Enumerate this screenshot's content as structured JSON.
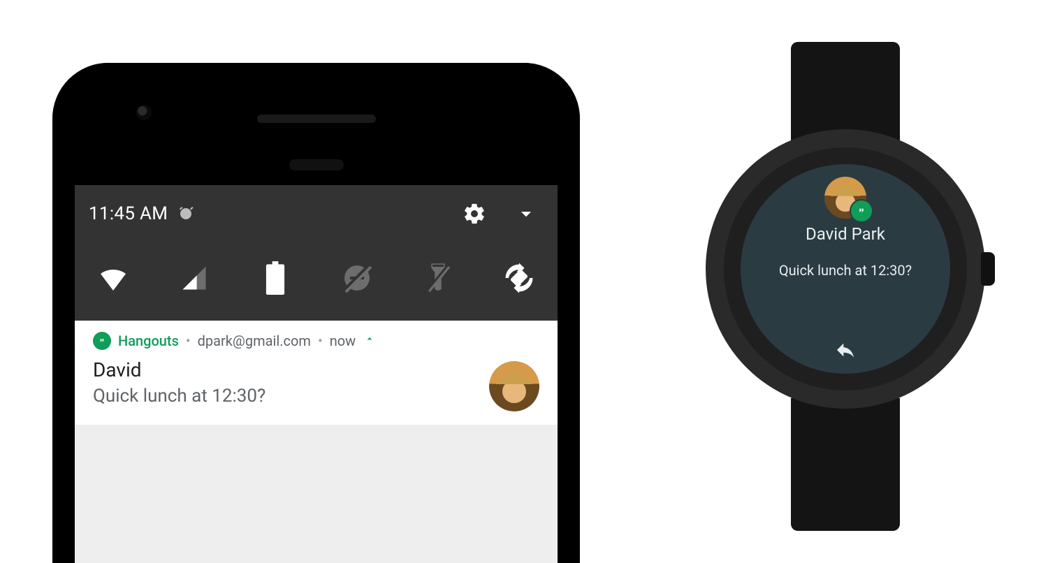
{
  "phone": {
    "status": {
      "time": "11:45 AM"
    },
    "quick_settings": {
      "tiles": [
        "wifi",
        "cellular",
        "battery",
        "dnd-off",
        "flashlight-off",
        "auto-rotate"
      ]
    },
    "notification": {
      "app_name": "Hangouts",
      "account": "dpark@gmail.com",
      "time": "now",
      "title": "David",
      "text": "Quick lunch at 12:30?"
    }
  },
  "watch": {
    "sender": "David Park",
    "message": "Quick lunch at 12:30?"
  }
}
